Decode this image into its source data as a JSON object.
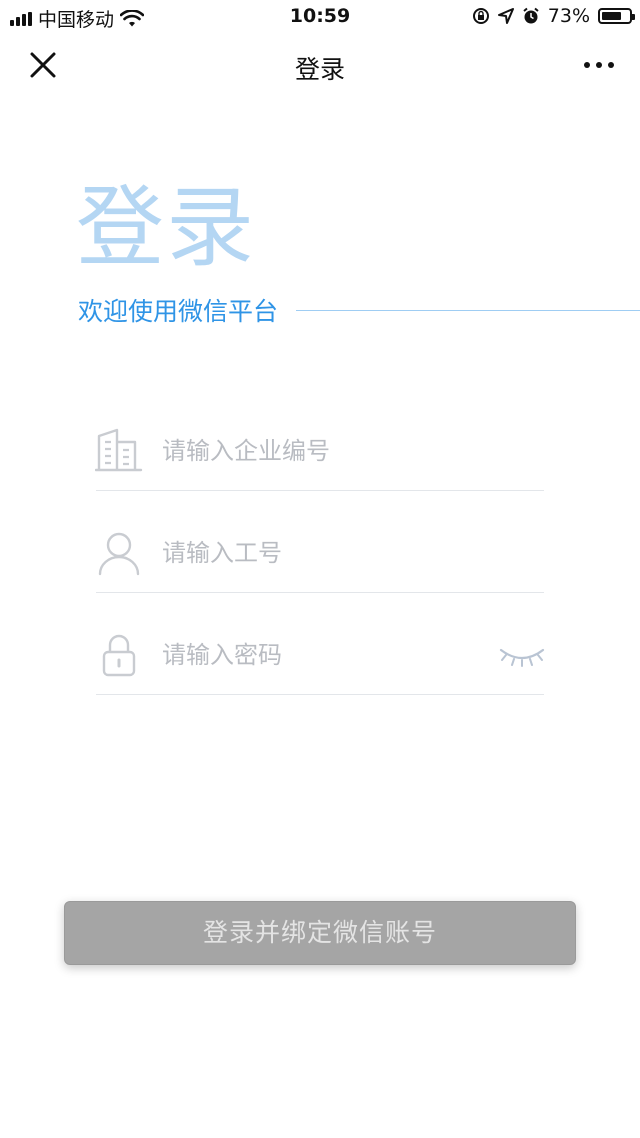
{
  "status_bar": {
    "carrier": "中国移动",
    "time": "10:59",
    "battery_percent": "73%",
    "battery_level": 0.73,
    "icons": [
      "signal-icon",
      "wifi-icon",
      "orientation-lock-icon",
      "location-icon",
      "alarm-icon",
      "battery-icon"
    ]
  },
  "nav": {
    "title": "登录",
    "close_icon": "close-icon",
    "more_icon": "more-icon"
  },
  "hero": {
    "title": "登录",
    "subtitle": "欢迎使用微信平台"
  },
  "form": {
    "company": {
      "placeholder": "请输入企业编号",
      "value": "",
      "icon": "building-icon"
    },
    "employee": {
      "placeholder": "请输入工号",
      "value": "",
      "icon": "user-icon"
    },
    "password": {
      "placeholder": "请输入密码",
      "value": "",
      "icon": "lock-icon",
      "toggle_icon": "eye-closed-icon"
    }
  },
  "submit": {
    "label": "登录并绑定微信账号"
  },
  "colors": {
    "accent": "#2f94e6",
    "hero_title": "#b4d6f3",
    "button_disabled": "#a5a5a5",
    "placeholder": "#b9bcc2"
  }
}
